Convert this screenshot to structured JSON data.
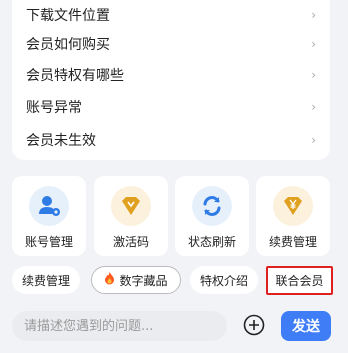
{
  "faq": {
    "items": [
      {
        "label": "下载文件位置"
      },
      {
        "label": "会员如何购买"
      },
      {
        "label": "会员特权有哪些"
      },
      {
        "label": "账号异常"
      },
      {
        "label": "会员未生效"
      }
    ],
    "chevron": "›"
  },
  "actions": [
    {
      "label": "账号管理",
      "icon": "user-gear-icon",
      "color": "#2f7be6"
    },
    {
      "label": "激活码",
      "icon": "diamond-icon",
      "color": "#e0a020"
    },
    {
      "label": "状态刷新",
      "icon": "refresh-icon",
      "color": "#2f7be6"
    },
    {
      "label": "续费管理",
      "icon": "yen-diamond-icon",
      "color": "#e0a020"
    }
  ],
  "chips": [
    {
      "label": "续费管理"
    },
    {
      "label": "数字藏品",
      "icon": "fire-icon"
    },
    {
      "label": "特权介绍"
    },
    {
      "label": "联合会员"
    }
  ],
  "composer": {
    "placeholder": "请描述您遇到的问题...",
    "send_label": "发送"
  },
  "colors": {
    "accent": "#3f7df7",
    "highlight": "#e02020",
    "background": "#f2f3f7"
  }
}
